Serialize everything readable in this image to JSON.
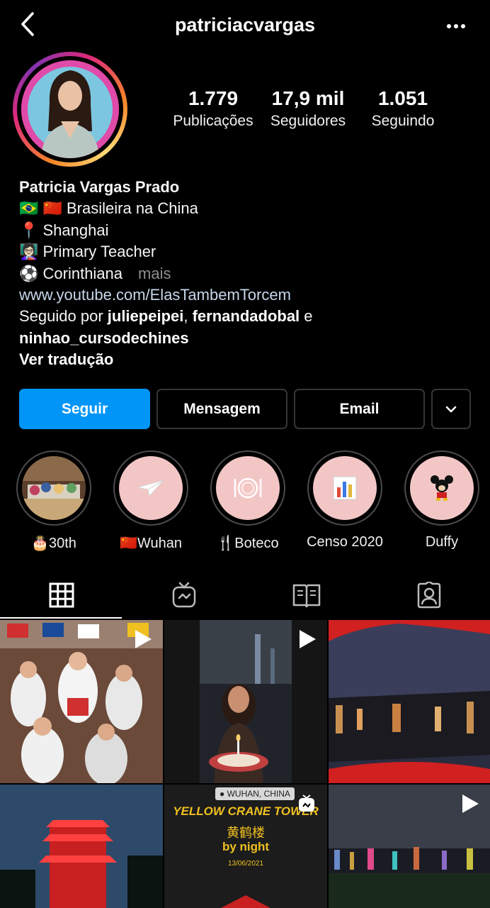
{
  "header": {
    "username": "patriciacvargas"
  },
  "stats": [
    {
      "value": "1.779",
      "label": "Publicações"
    },
    {
      "value": "17,9 mil",
      "label": "Seguidores"
    },
    {
      "value": "1.051",
      "label": "Seguindo"
    }
  ],
  "bio": {
    "name": "Patricia Vargas Prado",
    "line1": "🇧🇷 🇨🇳 Brasileira na China",
    "line2": "📍 Shanghai",
    "line3": "👩🏻‍🏫 Primary Teacher",
    "line4": "⚽ Corinthiana",
    "more": "mais",
    "link": "www.youtube.com/ElasTambemTorcem",
    "followed_prefix": "Seguido por ",
    "followed_user1": "juliepeipei",
    "followed_sep": ", ",
    "followed_user2": "fernandadobal",
    "followed_and": " e",
    "followed_user3": "ninhao_cursodechines",
    "translate": "Ver tradução"
  },
  "actions": {
    "follow": "Seguir",
    "message": "Mensagem",
    "email": "Email"
  },
  "highlights": [
    {
      "label": "🎂30th"
    },
    {
      "label": "🇨🇳Wuhan"
    },
    {
      "label": "🍴Boteco"
    },
    {
      "label": "Censo 2020"
    },
    {
      "label": "Duffy"
    }
  ],
  "posts": {
    "p5_location": "WUHAN, CHINA",
    "p5_title": "YELLOW CRANE TOWER",
    "p5_chinese": "黄鹤楼",
    "p5_sub": "by night",
    "p5_date": "13/06/2021"
  },
  "colors": {
    "accent": "#0095f6",
    "highlight_bg": "#f3c6c6"
  }
}
